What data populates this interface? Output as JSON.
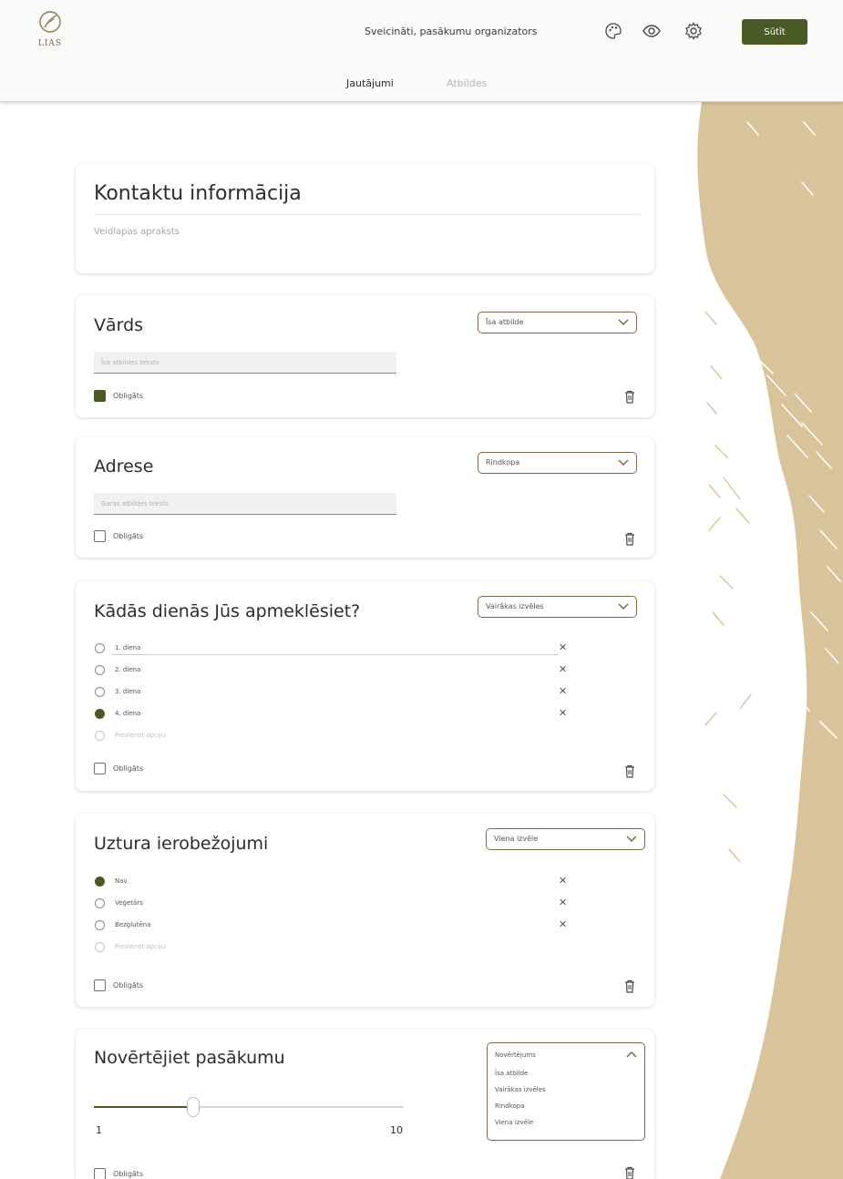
{
  "header": {
    "logo_text": "LIAS",
    "greeting": "Sveicināti, pasākumu organizators",
    "send_label": "Sūtīt",
    "tabs": [
      {
        "label": "Jautājumi",
        "active": true
      },
      {
        "label": "Atbildes",
        "active": false
      }
    ]
  },
  "form": {
    "title": "Kontaktu informācija",
    "description": "Veidlapas apraksts"
  },
  "questions": [
    {
      "title": "Vārds",
      "type_label": "Īsa atbilde",
      "input_placeholder": "Īsa atbildes teksts",
      "required_label": "Obligāts",
      "required": true
    },
    {
      "title": "Adrese",
      "type_label": "Rindkopa",
      "input_placeholder": "Garas atbildes teksts",
      "required_label": "Obligāts",
      "required": false
    },
    {
      "title": "Kādās dienās Jūs apmeklēsiet?",
      "type_label": "Vairākas izvēles",
      "options": [
        "1. diena",
        "2. diena",
        "3. diena",
        "4. diena"
      ],
      "selected_index": 3,
      "add_option": "Pievienot opciju",
      "required_label": "Obligāts",
      "required": false
    },
    {
      "title": "Uztura ierobežojumi",
      "type_label": "Viena izvēle",
      "options": [
        "Nav",
        "Veģetārs",
        "Bezglutēna"
      ],
      "selected_index": 0,
      "add_option": "Pievienot opciju",
      "required_label": "Obligāts",
      "required": false
    },
    {
      "title": "Novērtējiet pasākumu",
      "type_label": "Novērtējums",
      "scale_min": "1",
      "scale_max": "10",
      "slider_value_fraction": 0.32,
      "dropdown_open": true,
      "dropdown_options": [
        "Īsa atbilde",
        "Vairākas izvēles",
        "Rindkopa",
        "Viena izvēle"
      ],
      "required_label": "Obligāts",
      "required": false
    }
  ],
  "colors": {
    "accent": "#4a5a26",
    "brand_tan": "#d9c39a",
    "border_brown": "#7a6a48"
  },
  "icons": {
    "palette": "palette-icon",
    "preview": "eye-icon",
    "settings": "gear-icon",
    "delete": "trash-icon",
    "remove_option": "close-icon",
    "expand": "chevron-down-icon"
  }
}
